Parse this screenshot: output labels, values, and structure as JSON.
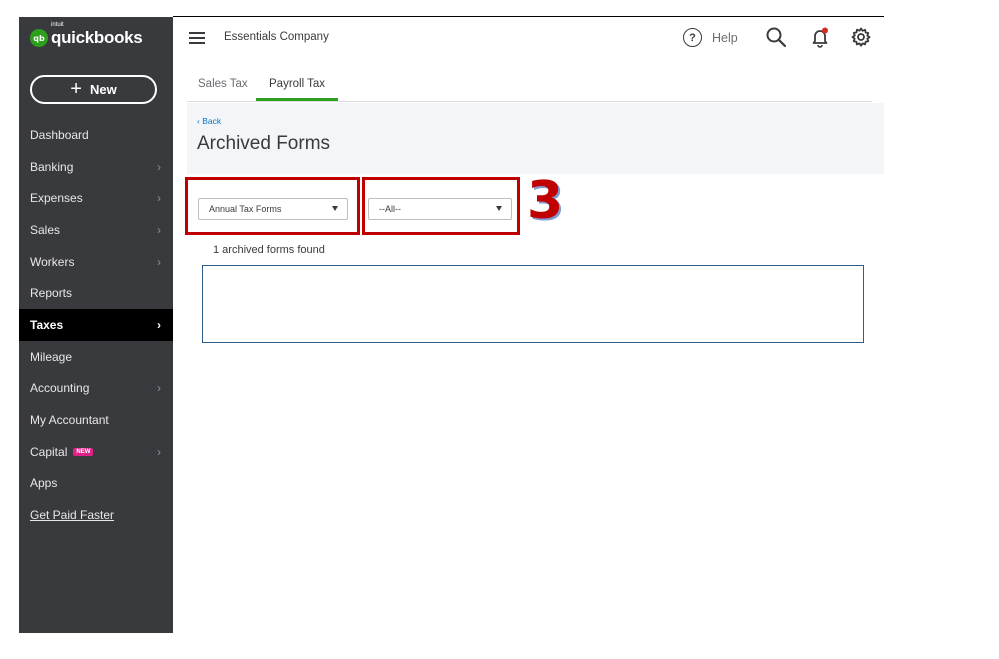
{
  "brand": {
    "badge": "qb",
    "intuit": "intuit",
    "name": "quickbooks",
    "green": "#2ca01c"
  },
  "new_button": {
    "label": "New"
  },
  "sidebar": {
    "items": [
      {
        "label": "Dashboard",
        "chevron": ""
      },
      {
        "label": "Banking",
        "chevron": "›"
      },
      {
        "label": "Expenses",
        "chevron": "›"
      },
      {
        "label": "Sales",
        "chevron": "›"
      },
      {
        "label": "Workers",
        "chevron": "›"
      },
      {
        "label": "Reports",
        "chevron": ""
      },
      {
        "label": "Taxes",
        "chevron": "›"
      },
      {
        "label": "Mileage",
        "chevron": ""
      },
      {
        "label": "Accounting",
        "chevron": "›"
      },
      {
        "label": "My Accountant",
        "chevron": ""
      },
      {
        "label": "Capital",
        "badge": "NEW",
        "chevron": "›"
      },
      {
        "label": "Apps",
        "chevron": ""
      },
      {
        "label": "Get Paid Faster",
        "chevron": ""
      }
    ],
    "active_index": 6
  },
  "topbar": {
    "company": "Essentials Company",
    "help_label": "Help",
    "help_glyph": "?"
  },
  "tabs": [
    {
      "label": "Sales Tax"
    },
    {
      "label": "Payroll Tax"
    }
  ],
  "page": {
    "back_label": "Back",
    "back_glyph": "‹",
    "title": "Archived Forms"
  },
  "filters": {
    "form_type": {
      "selected": "Annual Tax Forms"
    },
    "period": {
      "selected": "--All--"
    }
  },
  "annotation": {
    "step": "3",
    "color": "#c00000"
  },
  "results": {
    "summary": "1 archived forms found"
  }
}
